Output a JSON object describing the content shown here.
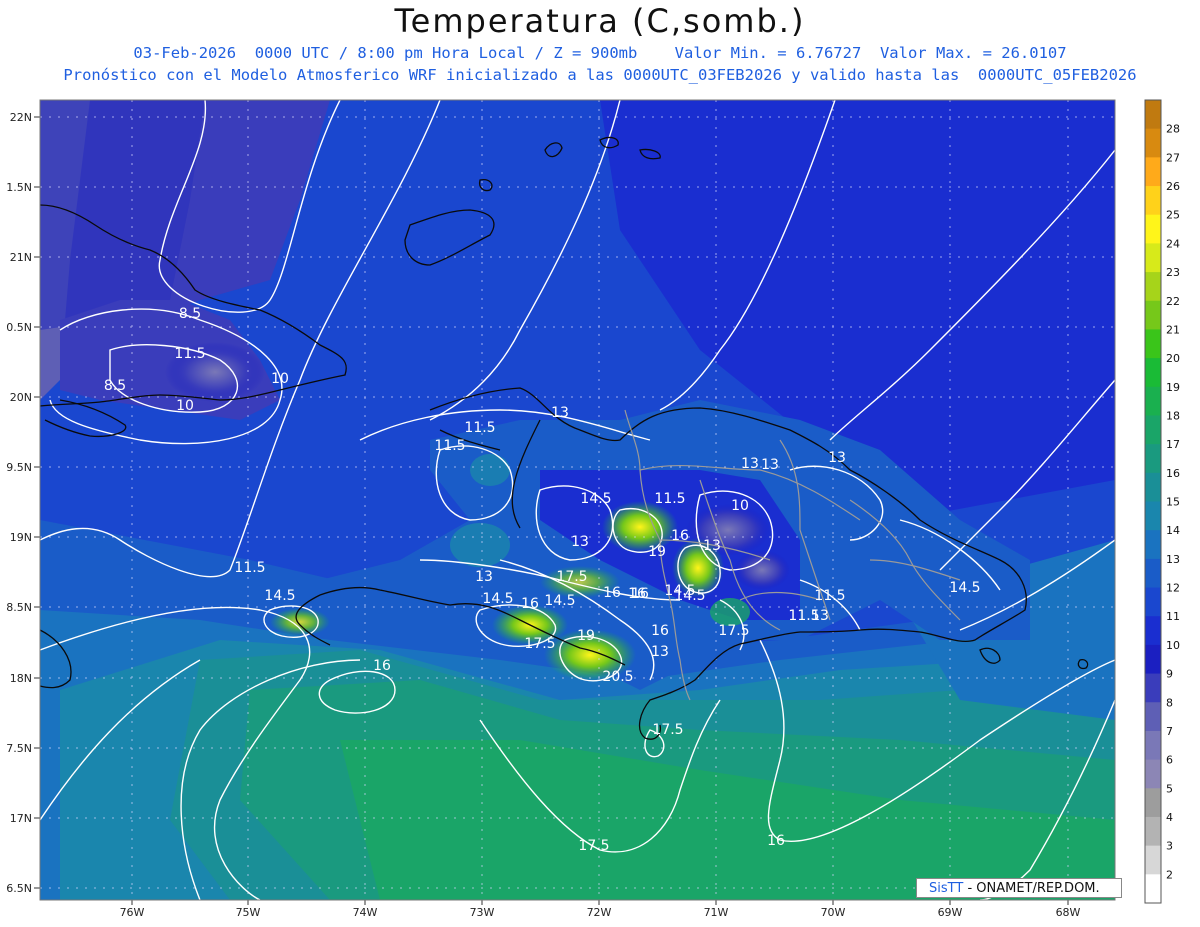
{
  "title": "Temperatura (C,somb.)",
  "subtitle_line1": "03-Feb-2026  0000 UTC / 8:00 pm Hora Local / Z = 900mb    Valor Min. = 6.76727  Valor Max. = 26.0107",
  "subtitle_line2": "Pronóstico con el Modelo Atmosferico WRF inicializado a las 0000UTC_03FEB2026 y valido hasta las  0000UTC_05FEB2026",
  "credit": {
    "brand": "SisTT",
    "org": "- ONAMET/REP.DOM."
  },
  "lat_labels": [
    "22N",
    "1.5N",
    "21N",
    "0.5N",
    "20N",
    "9.5N",
    "19N",
    "8.5N",
    "18N",
    "7.5N",
    "17N",
    "6.5N"
  ],
  "lon_labels": [
    "76W",
    "75W",
    "74W",
    "73W",
    "72W",
    "71W",
    "70W",
    "69W",
    "68W"
  ],
  "colorbar": {
    "levels": [
      "2",
      "3",
      "4",
      "5",
      "6",
      "7",
      "8",
      "9",
      "10",
      "11",
      "12",
      "13",
      "14",
      "15",
      "16",
      "17",
      "18",
      "19",
      "20",
      "21",
      "22",
      "23",
      "24",
      "25",
      "26",
      "27",
      "28"
    ],
    "colors": [
      "#ffffff",
      "#d7d7d7",
      "#b3b3b3",
      "#9d9d9d",
      "#8c86b5",
      "#7a78b7",
      "#5e5fb5",
      "#3a3dbb",
      "#1b1fc1",
      "#1a2ed0",
      "#1a47cf",
      "#1a5cc8",
      "#1a73c0",
      "#1a86ad",
      "#1a8f97",
      "#1a9a7f",
      "#1aa568",
      "#1ab04f",
      "#1abb36",
      "#3ac51a",
      "#76c81a",
      "#a6d41a",
      "#d7ea1a",
      "#fff51a",
      "#ffd21a",
      "#ffaa1a",
      "#d88a10",
      "#c07a10"
    ]
  },
  "contour_labels": [
    "8.5",
    "11.5",
    "8.5",
    "10",
    "10",
    "11.5",
    "11.5",
    "13",
    "11.5",
    "13",
    "14.5",
    "11.5",
    "10",
    "13",
    "13",
    "17.5",
    "19",
    "16",
    "13",
    "13",
    "14.5",
    "16",
    "14.5",
    "13",
    "11.5",
    "14.5",
    "16",
    "14.5",
    "16",
    "19",
    "17.5",
    "17.5",
    "16",
    "13",
    "20.5",
    "17.5",
    "11.5",
    "16",
    "17.5",
    "16",
    "14.5",
    "13",
    "14.5",
    "16"
  ]
}
